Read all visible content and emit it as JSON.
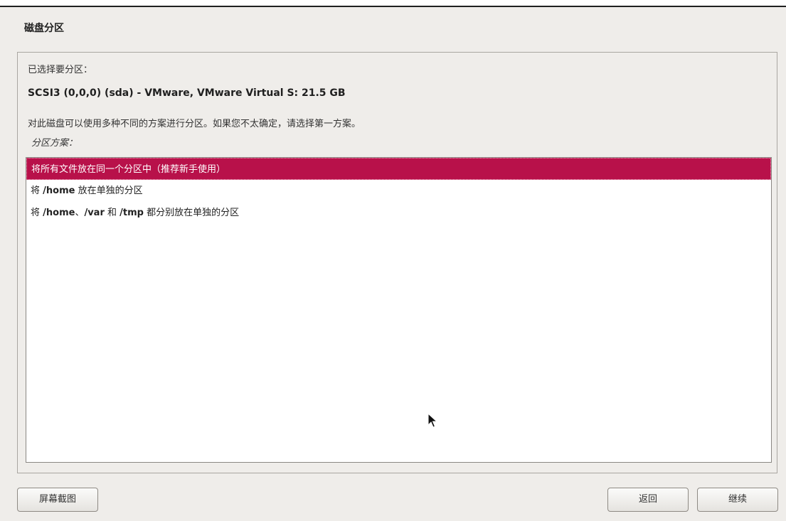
{
  "header": {
    "title": "磁盘分区"
  },
  "panel": {
    "selected_label": "已选择要分区：",
    "disk": "SCSI3 (0,0,0) (sda) - VMware, VMware Virtual S: 21.5 GB",
    "description": "对此磁盘可以使用多种不同的方案进行分区。如果您不太确定，请选择第一方案。",
    "scheme_label": "分区方案："
  },
  "schemes": [
    {
      "label": "将所有文件放在同一个分区中（推荐新手使用）",
      "selected": true
    },
    {
      "prefix": "将 ",
      "bold": "/home",
      "suffix": " 放在单独的分区",
      "selected": false
    },
    {
      "prefix": "将 ",
      "bold1": "/home",
      "sep1": "、",
      "bold2": "/var",
      "sep2": " 和 ",
      "bold3": "/tmp",
      "suffix": " 都分别放在单独的分区",
      "selected": false
    }
  ],
  "buttons": {
    "screenshot": "屏幕截图",
    "back": "返回",
    "continue": "继续"
  },
  "colors": {
    "selection": "#b8114a",
    "background": "#efedea"
  }
}
